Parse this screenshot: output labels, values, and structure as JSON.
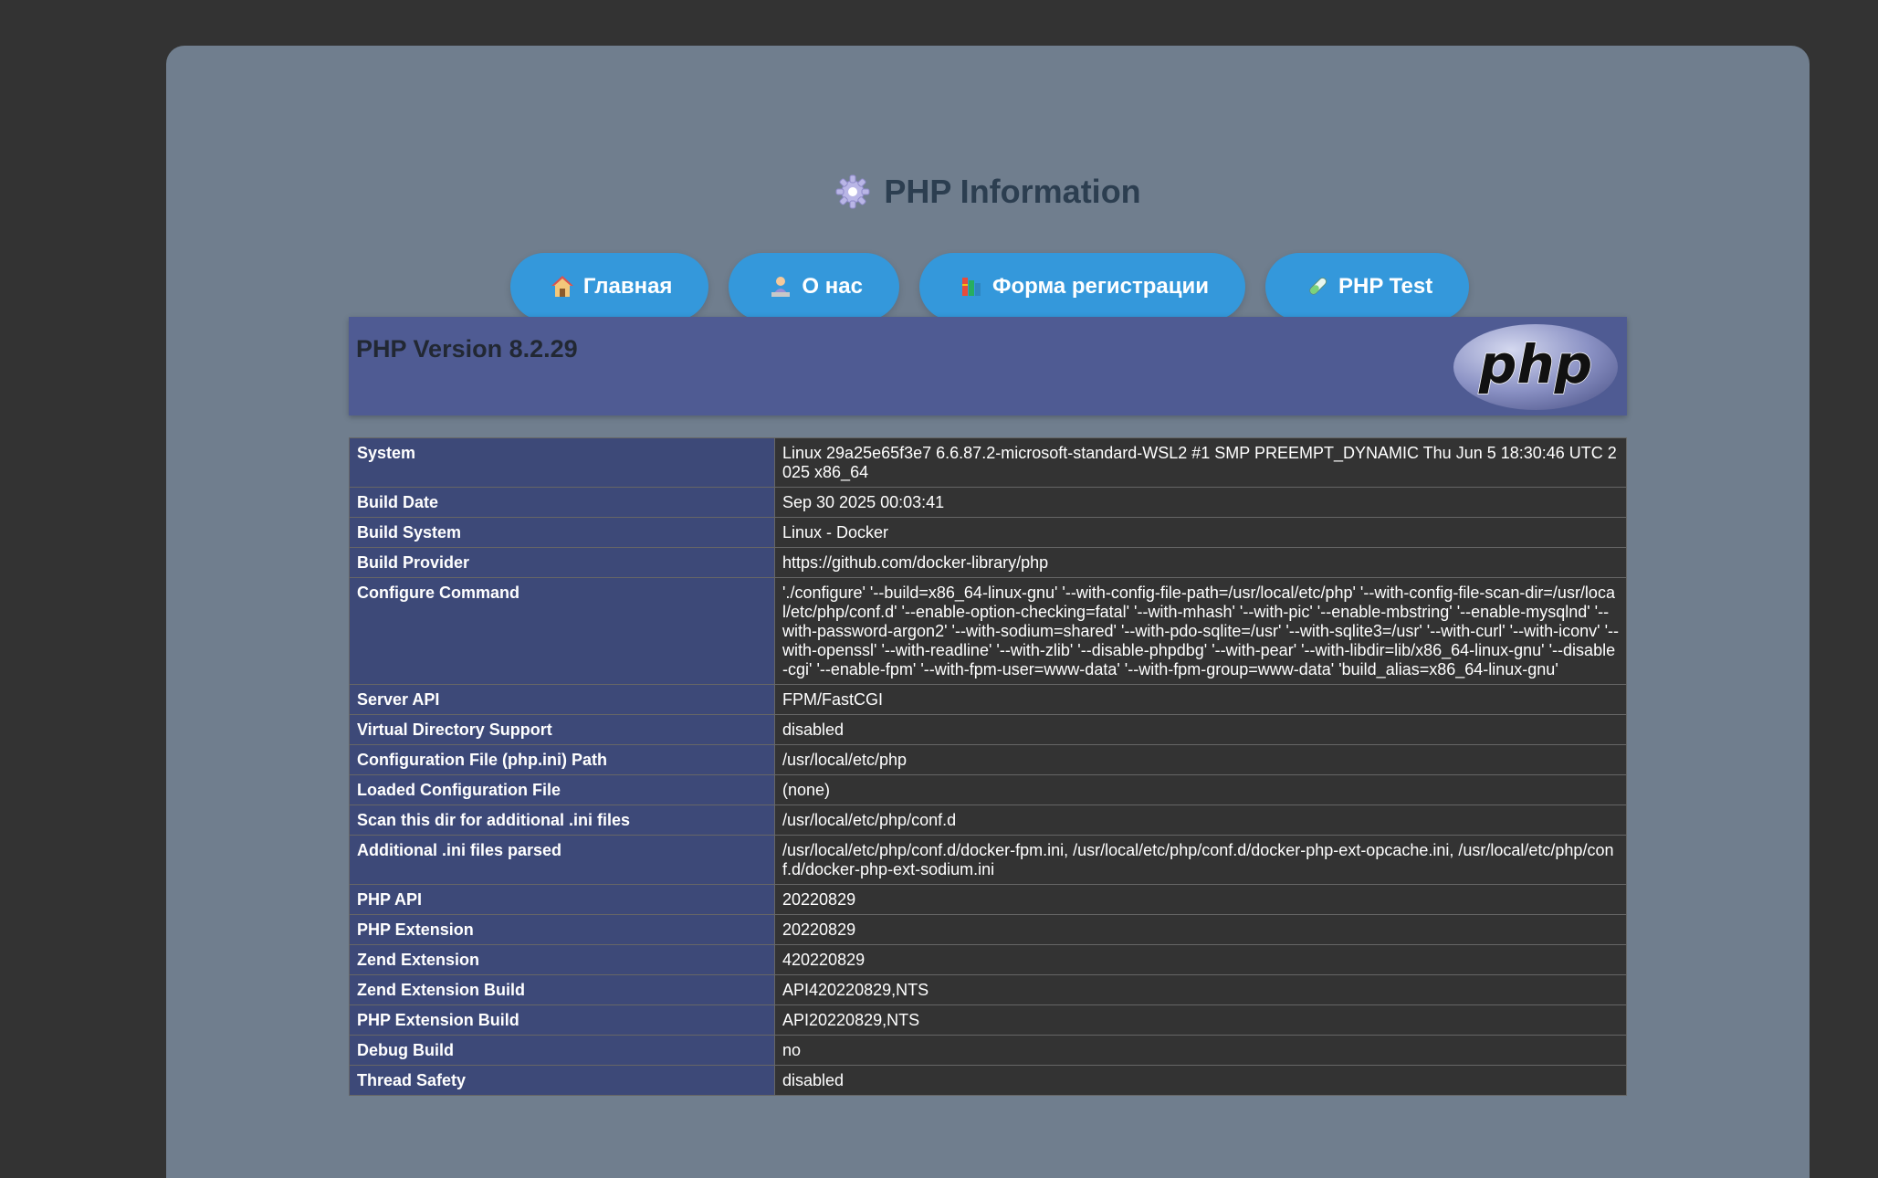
{
  "title": "PHP Information",
  "title_icon": "gear-icon",
  "nav": [
    {
      "label": "Главная",
      "icon": "house-icon"
    },
    {
      "label": "О нас",
      "icon": "person-at-laptop-icon"
    },
    {
      "label": "Форма регистрации",
      "icon": "books-icon"
    },
    {
      "label": "PHP Test",
      "icon": "test-tube-icon"
    }
  ],
  "phpinfo": {
    "version": "PHP Version 8.2.29",
    "logo_text": "php",
    "rows": [
      {
        "key": "System",
        "value": "Linux 29a25e65f3e7 6.6.87.2-microsoft-standard-WSL2 #1 SMP PREEMPT_DYNAMIC Thu Jun 5 18:30:46 UTC 2025 x86_64"
      },
      {
        "key": "Build Date",
        "value": "Sep 30 2025 00:03:41"
      },
      {
        "key": "Build System",
        "value": "Linux - Docker"
      },
      {
        "key": "Build Provider",
        "value": "https://github.com/docker-library/php"
      },
      {
        "key": "Configure Command",
        "value": "'./configure' '--build=x86_64-linux-gnu' '--with-config-file-path=/usr/local/etc/php' '--with-config-file-scan-dir=/usr/local/etc/php/conf.d' '--enable-option-checking=fatal' '--with-mhash' '--with-pic' '--enable-mbstring' '--enable-mysqlnd' '--with-password-argon2' '--with-sodium=shared' '--with-pdo-sqlite=/usr' '--with-sqlite3=/usr' '--with-curl' '--with-iconv' '--with-openssl' '--with-readline' '--with-zlib' '--disable-phpdbg' '--with-pear' '--with-libdir=lib/x86_64-linux-gnu' '--disable-cgi' '--enable-fpm' '--with-fpm-user=www-data' '--with-fpm-group=www-data' 'build_alias=x86_64-linux-gnu'"
      },
      {
        "key": "Server API",
        "value": "FPM/FastCGI"
      },
      {
        "key": "Virtual Directory Support",
        "value": "disabled"
      },
      {
        "key": "Configuration File (php.ini) Path",
        "value": "/usr/local/etc/php"
      },
      {
        "key": "Loaded Configuration File",
        "value": "(none)"
      },
      {
        "key": "Scan this dir for additional .ini files",
        "value": "/usr/local/etc/php/conf.d"
      },
      {
        "key": "Additional .ini files parsed",
        "value": "/usr/local/etc/php/conf.d/docker-fpm.ini, /usr/local/etc/php/conf.d/docker-php-ext-opcache.ini, /usr/local/etc/php/conf.d/docker-php-ext-sodium.ini"
      },
      {
        "key": "PHP API",
        "value": "20220829"
      },
      {
        "key": "PHP Extension",
        "value": "20220829"
      },
      {
        "key": "Zend Extension",
        "value": "420220829"
      },
      {
        "key": "Zend Extension Build",
        "value": "API420220829,NTS"
      },
      {
        "key": "PHP Extension Build",
        "value": "API20220829,NTS"
      },
      {
        "key": "Debug Build",
        "value": "no"
      },
      {
        "key": "Thread Safety",
        "value": "disabled"
      }
    ]
  },
  "colors": {
    "background": "#333333",
    "container": "#707e8e",
    "button": "#3498db",
    "header": "#4f5b93",
    "key_cell": "#3d4978",
    "value_cell": "#333333"
  }
}
